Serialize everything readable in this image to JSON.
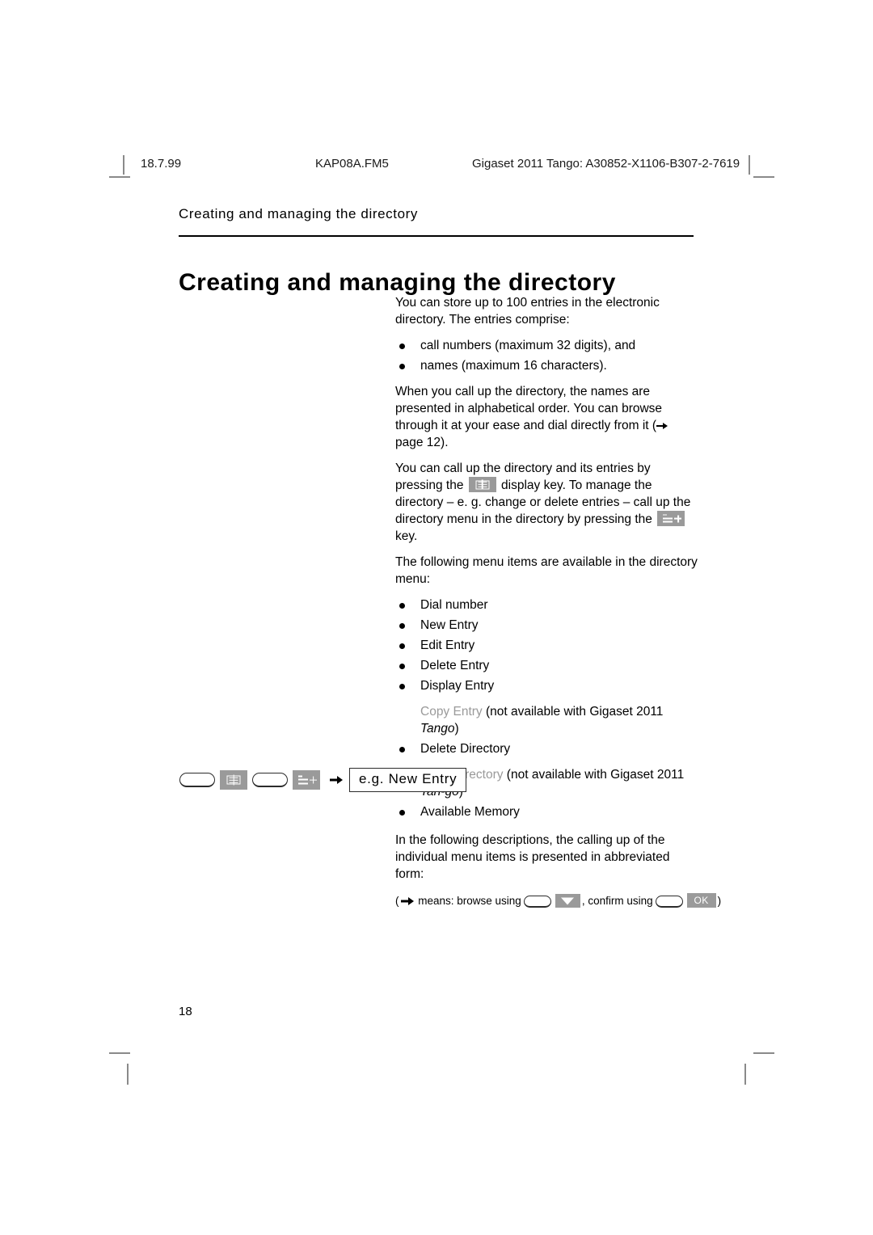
{
  "header": {
    "date": "18.7.99",
    "file": "KAP08A.FM5",
    "document": "Gigaset 2011 Tango: A30852-X1106-B307-2-7619"
  },
  "running_title": "Creating and managing the directory",
  "chapter_title": "Creating and managing the directory",
  "body": {
    "intro": "You can store up to 100 entries in the electronic directory. The entries comprise:",
    "entry_bullets": [
      "call numbers (maximum 32 digits), and",
      "names (maximum 16 characters)."
    ],
    "alphabetical_para_1": "When you call up the directory, the names are presented in alphabetical order. You can browse through it at your ease and dial directly from it (",
    "alphabetical_para_2": " page 12).",
    "callup_para_1": "You can call up the directory and its entries by pressing the ",
    "callup_para_2": " display key. To manage the directory – e. g. change or delete entries – call up the directory menu in the directory by pressing the ",
    "callup_para_3": " key.",
    "menu_intro": "The following menu items are available in the directory menu:",
    "menu_items": [
      {
        "label": "Dial number",
        "bulleted": true,
        "dim": false,
        "note": ""
      },
      {
        "label": "New Entry",
        "bulleted": true,
        "dim": false,
        "note": ""
      },
      {
        "label": "Edit Entry",
        "bulleted": true,
        "dim": false,
        "note": ""
      },
      {
        "label": "Delete Entry",
        "bulleted": true,
        "dim": false,
        "note": ""
      },
      {
        "label": "Display Entry",
        "bulleted": true,
        "dim": false,
        "note": ""
      },
      {
        "label": "Copy Entry",
        "bulleted": false,
        "dim": true,
        "note_pre": " (not available with Gigaset 2011 ",
        "note_ital": "Tango",
        "note_post": ")"
      },
      {
        "label": "Delete Directory",
        "bulleted": true,
        "dim": false,
        "note": ""
      },
      {
        "label": "Copy Directory",
        "bulleted": false,
        "dim": true,
        "note_pre": " (not available with Gigaset 2011 ",
        "note_ital": "Tan-go",
        "note_post": ")"
      },
      {
        "label": "Available Memory",
        "bulleted": true,
        "dim": false,
        "note": ""
      }
    ],
    "abbrev_para": "In the following descriptions, the calling up of the individual menu items is presented in abbreviated form:",
    "legend": {
      "open_paren": "(",
      "means_text": " means: browse using",
      "confirm_text": ", confirm using",
      "close_paren": ")",
      "ok_label": "OK"
    }
  },
  "example": {
    "box_text": "e.g. New Entry"
  },
  "page_number": "18",
  "colors": {
    "key_gray": "#9a9a9a",
    "dim_text": "#9a9a9a",
    "rule": "#000000",
    "crop_mark": "#8a8a8a"
  }
}
